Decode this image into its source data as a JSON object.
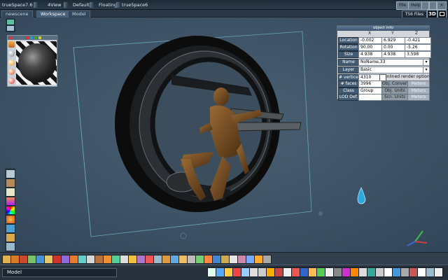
{
  "titlebar": {
    "app_title": "trueSpace7.6",
    "views": [
      "4View",
      "Default",
      "Floating",
      "trueSpace6"
    ],
    "file_label": "File",
    "help_label": "Help"
  },
  "tabs": {
    "items": [
      {
        "label": "newscene",
        "active": false
      },
      {
        "label": "Workspace",
        "active": true
      },
      {
        "label": "Model",
        "active": false
      }
    ],
    "ts6_files_label": "TS6 Files",
    "mode_3d_label": "3D"
  },
  "object_info": {
    "title": "object info",
    "columns": [
      "X",
      "Y",
      "Z"
    ],
    "location": {
      "label": "Location",
      "x": "-0.002",
      "y": "6.929",
      "z": "-0.421"
    },
    "rotation": {
      "label": "Rotation",
      "x": "90.00",
      "y": "0.00",
      "z": "-5.26"
    },
    "size": {
      "label": "Size",
      "x": "4.938",
      "y": "4.938",
      "z": "3.598"
    },
    "name": {
      "label": "Name",
      "value": "NoName,33"
    },
    "layer": {
      "label": "Layer",
      "value": "Basic"
    },
    "vertices": {
      "label": "# vertices",
      "value": "4310"
    },
    "inlined_render_label": "inlined render options",
    "faces": {
      "label": "# faces",
      "value": "3996",
      "button": "Obj. Convert",
      "unit": "Meters"
    },
    "class": {
      "label": "Class",
      "value": "Group",
      "button": "Obj. Units",
      "unit": "Meters"
    },
    "lod": {
      "label": "LOD Def.",
      "value": "",
      "button": "Scn. Units",
      "unit": "Meters"
    }
  },
  "status": {
    "label": "Model"
  },
  "colors": {
    "viewport_bg": "#3e5262",
    "panel_header": "#425a72",
    "accent_selection": "#6fb8c8"
  },
  "icons": {
    "left_material": [
      "material-ball-icon",
      "paint-icon",
      "sphere-shader-icon",
      "red-light-icon"
    ],
    "left_lower": [
      "select-icon",
      "rotate-icon",
      "scale-icon",
      "paint-face-icon",
      "color-wheel-icon",
      "sphere-icon",
      "render-icon",
      "magic-wand-icon",
      "light-icon"
    ]
  }
}
